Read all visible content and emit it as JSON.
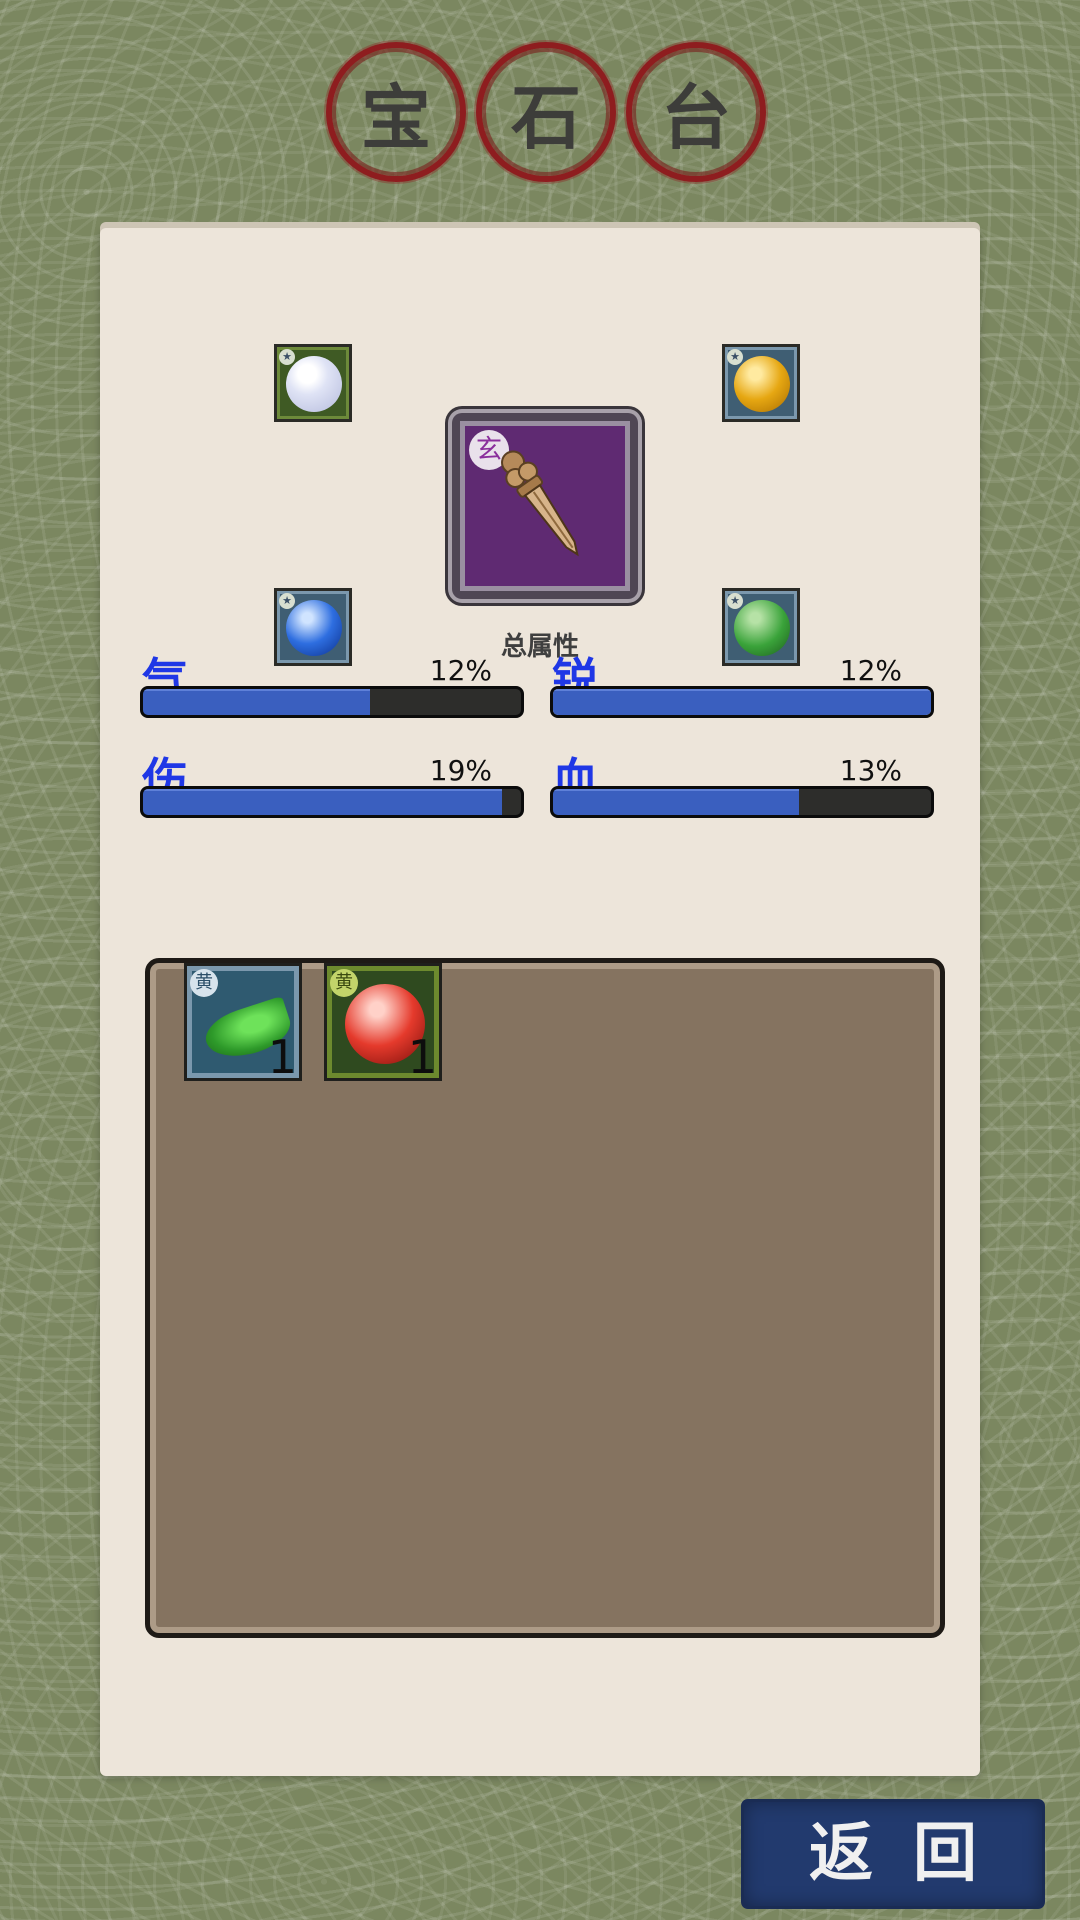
{
  "title": {
    "chars": [
      "宝",
      "石",
      "台"
    ]
  },
  "sockets": [
    {
      "name": "socket-top-left",
      "frame": "green",
      "gem": "white-gem-icon"
    },
    {
      "name": "socket-top-right",
      "frame": "blue",
      "gem": "yellow-gem-icon"
    },
    {
      "name": "socket-bottom-left",
      "frame": "blue",
      "gem": "blue-gem-icon"
    },
    {
      "name": "socket-bottom-right",
      "frame": "blue",
      "gem": "green-gem-icon"
    }
  ],
  "weapon": {
    "badge": "玄",
    "icon": "dagger-icon"
  },
  "total_attributes_label": "总属性",
  "stats": [
    {
      "name": "气",
      "percent_text": "12%",
      "fill": 0.6
    },
    {
      "name": "锐",
      "percent_text": "12%",
      "fill": 1.0
    },
    {
      "name": "伤",
      "percent_text": "19%",
      "fill": 0.95
    },
    {
      "name": "血",
      "percent_text": "13%",
      "fill": 0.65
    }
  ],
  "inventory": {
    "items": [
      {
        "badge": "黄",
        "count": "1",
        "icon": "green-leaf-gem-icon",
        "frame": "blue"
      },
      {
        "badge": "黄",
        "count": "1",
        "icon": "red-gem-icon",
        "frame": "green"
      }
    ]
  },
  "back_button": {
    "label": "返回"
  },
  "colors": {
    "background": "#7b8760",
    "panel": "#ede5da",
    "seal_red": "#8e1d1f",
    "stat_name_blue": "#1f37e6",
    "bar_fill": "#3a5fbf",
    "inventory_bg": "#857360",
    "back_button_bg": "#223a6e"
  }
}
